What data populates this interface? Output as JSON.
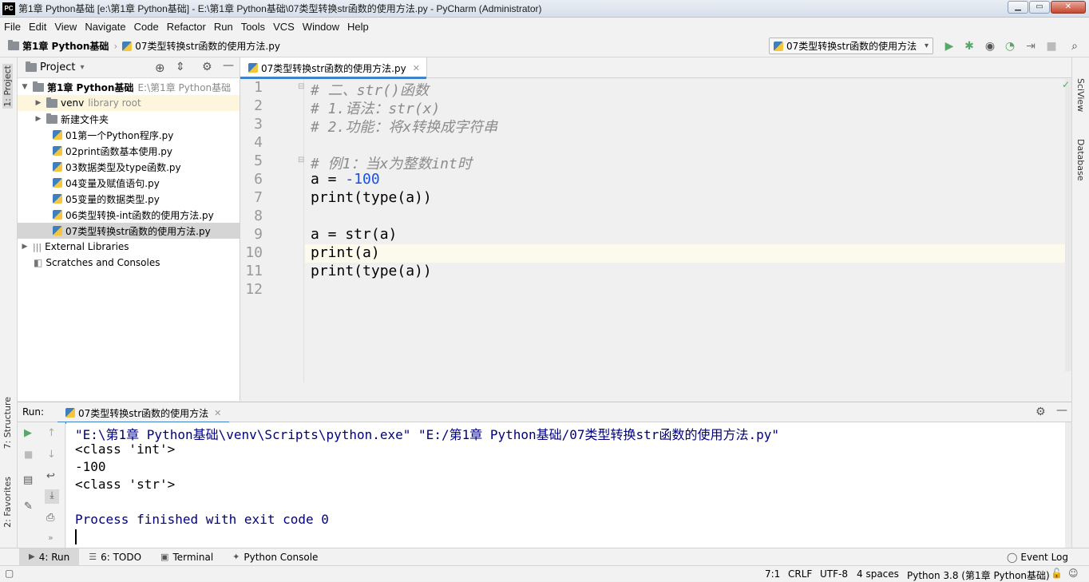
{
  "window": {
    "title": "第1章 Python基础 [e:\\第1章 Python基础] - E:\\第1章 Python基础\\07类型转换str函数的使用方法.py - PyCharm (Administrator)",
    "app_logo": "PC"
  },
  "menu": [
    "File",
    "Edit",
    "View",
    "Navigate",
    "Code",
    "Refactor",
    "Run",
    "Tools",
    "VCS",
    "Window",
    "Help"
  ],
  "breadcrumb": {
    "project": "第1章 Python基础",
    "file": "07类型转换str函数的使用方法.py"
  },
  "run_config": "07类型转换str函数的使用方法",
  "left_tabs": {
    "project": "1: Project",
    "structure": "7: Structure",
    "favorites": "2: Favorites"
  },
  "right_tabs": {
    "sciview": "SciView",
    "database": "Database"
  },
  "project_panel": {
    "title": "Project",
    "root": {
      "name": "第1章 Python基础",
      "path": "E:\\第1章 Python基础"
    },
    "venv": {
      "name": "venv",
      "note": "library root"
    },
    "folder": "新建文件夹",
    "files": [
      "01第一个Python程序.py",
      "02print函数基本使用.py",
      "03数据类型及type函数.py",
      "04变量及赋值语句.py",
      "05变量的数据类型.py",
      "06类型转换-int函数的使用方法.py",
      "07类型转换str函数的使用方法.py"
    ],
    "external": "External Libraries",
    "scratches": "Scratches and Consoles"
  },
  "editor": {
    "tab": "07类型转换str函数的使用方法.py",
    "line_numbers": [
      "1",
      "2",
      "3",
      "4",
      "5",
      "6",
      "7",
      "8",
      "9",
      "10",
      "11",
      "12"
    ],
    "lines": {
      "l1": "# 二、str()函数",
      "l2": "# 1.语法：str(x)",
      "l3": "# 2.功能：将x转换成字符串",
      "l5": "# 例1：当x为整数int时",
      "l6a": "a = ",
      "l6b": "-100",
      "l7": "print(type(a))",
      "l9": "a = str(a)",
      "l10": "print(a)",
      "l11": "print(type(a))"
    }
  },
  "run_panel": {
    "label": "Run:",
    "tab": "07类型转换str函数的使用方法",
    "output": [
      "\"E:\\第1章 Python基础\\venv\\Scripts\\python.exe\" \"E:/第1章 Python基础/07类型转换str函数的使用方法.py\"",
      "<class 'int'>",
      "-100",
      "<class 'str'>",
      "",
      "Process finished with exit code 0"
    ]
  },
  "bottom_tabs": [
    "4: Run",
    "6: TODO",
    "Terminal",
    "Python Console"
  ],
  "event_log": "Event Log",
  "status": {
    "position": "7:1",
    "line_sep": "CRLF",
    "encoding": "UTF-8",
    "indent": "4 spaces",
    "interpreter": "Python 3.8 (第1章 Python基础)"
  },
  "colors": {
    "accent": "#4083c9",
    "run_green": "#59a869",
    "selection": "#d5d5d5",
    "current_line": "#fcfaed"
  }
}
